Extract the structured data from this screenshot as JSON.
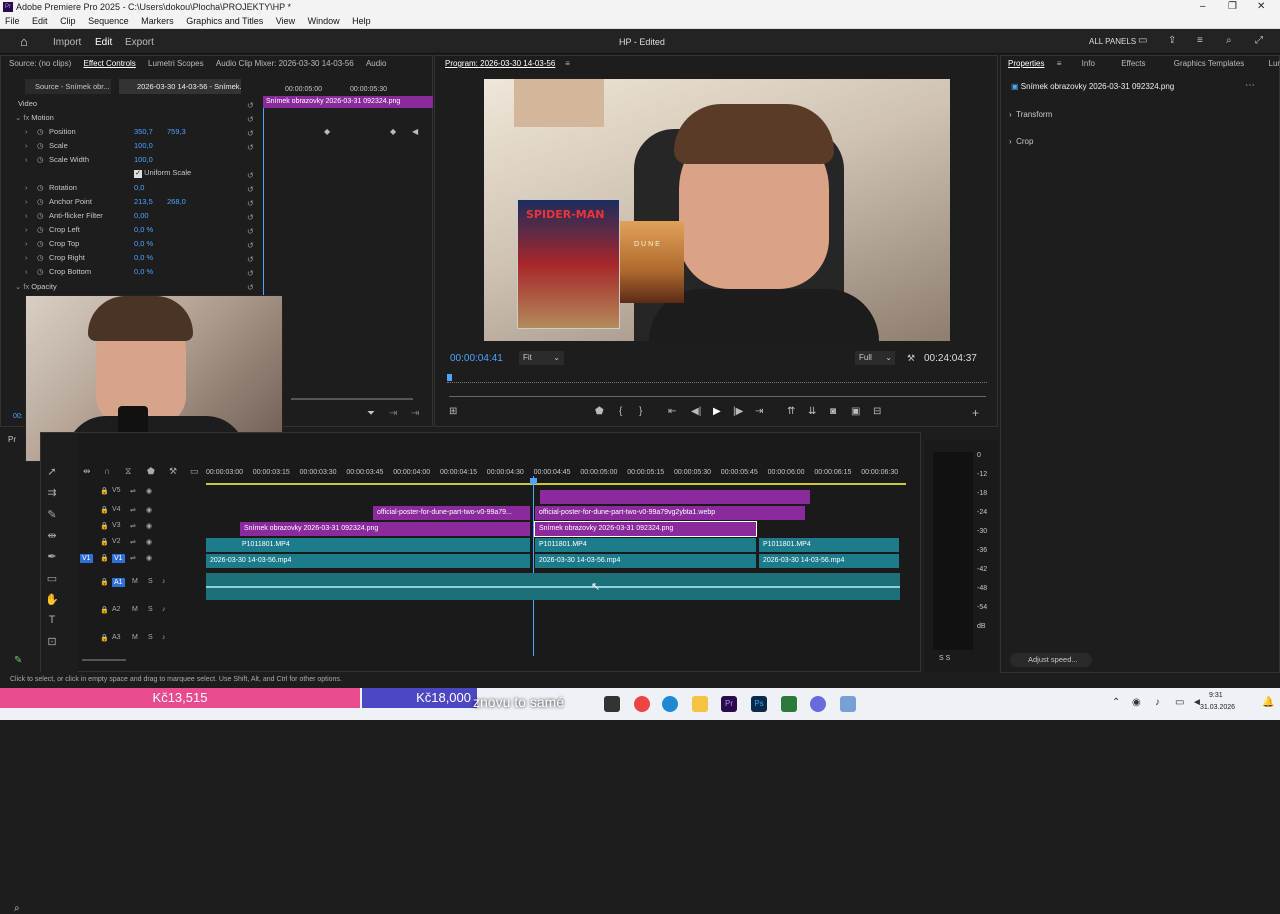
{
  "window": {
    "title": "Adobe Premiere Pro 2025 - C:\\Users\\dokou\\Plocha\\PROJEKTY\\HP *",
    "controls": [
      "–",
      "❐",
      "✕"
    ]
  },
  "menu": [
    "File",
    "Edit",
    "Clip",
    "Sequence",
    "Markers",
    "Graphics and Titles",
    "View",
    "Window",
    "Help"
  ],
  "header": {
    "tabs": [
      "Import",
      "Edit",
      "Export"
    ],
    "project": "HP - Edited",
    "all_panels": "ALL PANELS"
  },
  "left_tabs": {
    "source": "Source: (no clips)",
    "effect_controls": "Effect Controls",
    "lumetri": "Lumetri Scopes",
    "mixer": "Audio Clip Mixer: 2026-03-30 14-03-56",
    "audio": "Audio"
  },
  "subtabs": {
    "source": "Source - Snímek obr...",
    "seq": "2026-03-30 14-03-56 - Snímek..."
  },
  "mini_ruler": {
    "t1": "00:00:05:00",
    "t2": "00:00:05:30",
    "clip": "Snímek obrazovky 2026-03-31 092324.png"
  },
  "effects": {
    "video": "Video",
    "motion": "Motion",
    "props": [
      {
        "name": "Position",
        "v1": "350,7",
        "v2": "759,3"
      },
      {
        "name": "Scale",
        "v1": "100,0",
        "v2": ""
      },
      {
        "name": "Scale Width",
        "v1": "100,0",
        "v2": ""
      },
      {
        "name": "",
        "v1": "",
        "v2": ""
      },
      {
        "name": "Rotation",
        "v1": "0,0",
        "v2": ""
      },
      {
        "name": "Anchor Point",
        "v1": "213,5",
        "v2": "268,0"
      },
      {
        "name": "Anti-flicker Filter",
        "v1": "0,00",
        "v2": ""
      },
      {
        "name": "Crop Left",
        "v1": "0,0 %",
        "v2": ""
      },
      {
        "name": "Crop Top",
        "v1": "0,0 %",
        "v2": ""
      },
      {
        "name": "Crop Right",
        "v1": "0,0 %",
        "v2": ""
      },
      {
        "name": "Crop Bottom",
        "v1": "0,0 %",
        "v2": ""
      }
    ],
    "uniform": "Uniform Scale",
    "opacity": "Opacity",
    "timecode": "00:"
  },
  "program": {
    "title": "Program: 2026-03-30 14-03-56",
    "timecode": "00:00:04:41",
    "fit": "Fit",
    "quality": "Full",
    "duration": "00:24:04:37",
    "poster1": "SPIDER-MAN",
    "poster2": "DUNE"
  },
  "properties": {
    "tabs": [
      "Properties",
      "Info",
      "Effects",
      "Graphics Templates",
      "Lume"
    ],
    "clip": "Snímek obrazovky 2026-03-31 092324.png",
    "sections": [
      "Transform",
      "Crop"
    ],
    "adjust": "Adjust speed..."
  },
  "timeline": {
    "ruler": [
      "00:00:03:00",
      "00:00:03:15",
      "00:00:03:30",
      "00:00:03:45",
      "00:00:04:00",
      "00:00:04:15",
      "00:00:04:30",
      "00:00:04:45",
      "00:00:05:00",
      "00:00:05:15",
      "00:00:05:30",
      "00:00:05:45",
      "00:00:06:00",
      "00:00:06:15",
      "00:00:06:30"
    ],
    "tracks": [
      "V5",
      "V4",
      "V3",
      "V2",
      "V1",
      "A1",
      "A2",
      "A3"
    ],
    "clips": {
      "v4a": "official-poster-for-dune-part-two-v0-99a79...",
      "v4b": "official-poster-for-dune-part-two-v0-99a79vg2ybta1.webp",
      "v3a": "Snímek obrazovky 2026-03-31 092324.png",
      "v3b": "Snímek obrazovky 2026-03-31 092324.png",
      "v2a": "P1011801.MP4",
      "v2b": "P1011801.MP4",
      "v2c": "P1011801.MP4",
      "v1a": "2026-03-30 14-03-56.mp4",
      "v1b": "2026-03-30 14-03-56.mp4",
      "v1c": "2026-03-30 14-03-56.mp4"
    }
  },
  "meter": {
    "labels": [
      "0",
      "-12",
      "-18",
      "-24",
      "-30",
      "-36",
      "-42",
      "-48",
      "-54",
      "dB"
    ],
    "solo": "S  S"
  },
  "status": "Click to select, or click in empty space and drag to marquee select. Use Shift, Alt, and Ctrl for other options.",
  "overlay": {
    "price1": "Kč13,515",
    "price2": "Kč18,000",
    "caption": "znovu to samé"
  },
  "clock": {
    "time": "9:31",
    "date": "31.03.2026"
  }
}
